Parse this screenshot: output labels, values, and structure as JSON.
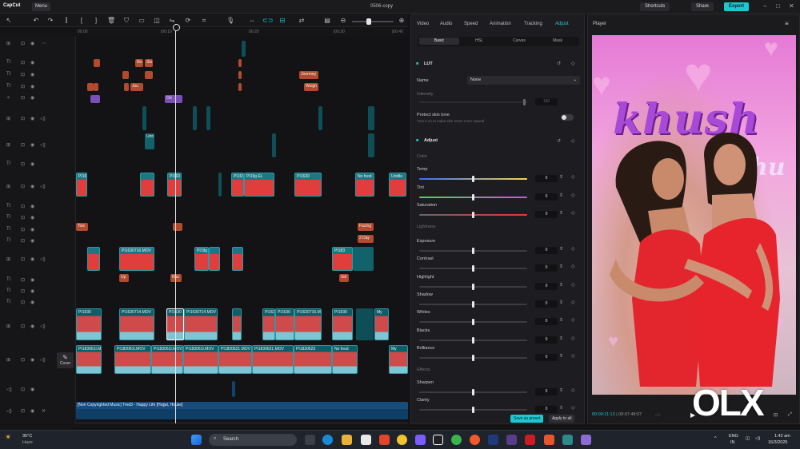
{
  "app": {
    "logo": "CapCut",
    "menu_label": "Menu",
    "project_title": "0506-copy",
    "shortcuts_label": "Shortcuts",
    "share_label": "Share",
    "export_label": "Export",
    "accent": "#1ec8d3"
  },
  "timeline": {
    "ruler_ticks": [
      "00:00",
      "|00:10",
      "00:20",
      "|00:30",
      "|00:40"
    ],
    "cover_label": "Cover",
    "text_clips": [
      "No",
      "Slo",
      "Jou",
      "Jourmey",
      "Weigh",
      "Ori",
      "Tow",
      "Facing",
      "2 Day",
      "Up",
      "Khu",
      "Sid"
    ],
    "video_clips": [
      "PI163",
      "PI163",
      "Unti",
      "PI1630",
      "PI1632",
      "No food",
      "Untitle",
      "PI1630716.MOV",
      "PI163",
      "PI19g",
      "PI19g EL",
      "PI1630",
      "PI1632",
      "No food",
      "PI183",
      "PI1630716.MOV"
    ],
    "main_clips": [
      "PI1635",
      "PI163",
      "PI1630714.MOV",
      "PI1630",
      "PI1630714.MOV",
      "PI163",
      "PI1630",
      "PI1630",
      "PI1630716.MOV",
      "PI1630",
      "PI1630",
      "My"
    ],
    "base_clips": [
      "PI183061I.MOV",
      "PI183061I.MOV",
      "PI183061I.MOV",
      "PI183061I.MOV",
      "PI1830621.MOV",
      "PI1830621.MOV",
      "PI1830623",
      "No food",
      "My"
    ],
    "audio_label": "[Non Copyrighted Music] Tred3 - Happy Life [Hojjat, House]"
  },
  "inspector": {
    "tabs": [
      "Video",
      "Audio",
      "Speed",
      "Animation",
      "Tracking",
      "Adjust"
    ],
    "active_tab": "Adjust",
    "subtabs": [
      "Basic",
      "HSL",
      "Curves",
      "Mask"
    ],
    "lut": {
      "title": "LUT",
      "name_label": "Name",
      "name_value": "None",
      "intensity_label": "Intensity",
      "intensity_value": "100"
    },
    "skin": {
      "title": "Protect skin tone",
      "desc": "Turn it on to make skin tones more natural."
    },
    "adjust_title": "Adjust",
    "color_section": "Color",
    "lightness_section": "Lightness",
    "effects_section": "Effects",
    "color_rows": [
      {
        "label": "Temp",
        "value": "0"
      },
      {
        "label": "Tint",
        "value": "0"
      },
      {
        "label": "Saturation",
        "value": "0"
      }
    ],
    "light_rows": [
      {
        "label": "Exposure",
        "value": "0"
      },
      {
        "label": "Contrast",
        "value": "0"
      },
      {
        "label": "Highlight",
        "value": "0"
      },
      {
        "label": "Shadow",
        "value": "0"
      },
      {
        "label": "Whites",
        "value": "0"
      },
      {
        "label": "Blacks",
        "value": "0"
      },
      {
        "label": "Brilliance",
        "value": "0"
      }
    ],
    "effect_rows": [
      {
        "label": "Sharpen",
        "value": "0"
      },
      {
        "label": "Clarity",
        "value": "0"
      }
    ],
    "save_preset": "Save as preset",
    "apply_all": "Apply to all"
  },
  "player": {
    "title": "Player",
    "overlay_text": "khush",
    "overlay_text2": "hu",
    "current_time": "00:00:11:13",
    "total_time": "00:07:48:07",
    "watermark": "OLX"
  },
  "taskbar": {
    "weather_temp": "35°C",
    "weather_desc": "Haze",
    "search_placeholder": "Search",
    "lang": "ENG",
    "region": "IN",
    "time": "1:42 am",
    "date": "16/3/2025"
  }
}
